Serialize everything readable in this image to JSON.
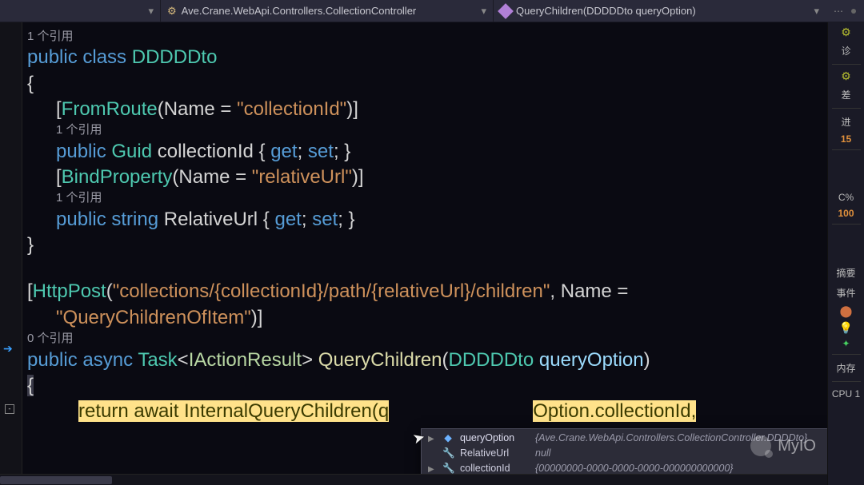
{
  "breadcrumb": {
    "class_label": "Ave.Crane.WebApi.Controllers.CollectionController",
    "method_label": "QueryChildren(DDDDDto queryOption)"
  },
  "rightstrip": {
    "diag_label": "诊",
    "diff_label": "差",
    "proc_label": "进",
    "num1": "15",
    "cpu_label": "C%",
    "cpu_value": "100",
    "summary_label": "摘要",
    "events_label": "事件",
    "mem_label": "内存",
    "cpu2_label": "CPU 1"
  },
  "code": {
    "ref1": "1 个引用",
    "class_decl": {
      "kw": "public class",
      "name": "DDDDDto"
    },
    "brace_open": "{",
    "attr1": {
      "open": "[",
      "name": "FromRoute",
      "args": "(Name = ",
      "str": "\"collectionId\"",
      "close": ")]"
    },
    "ref2": "1 个引用",
    "prop1": {
      "kw1": "public",
      "type": "Guid",
      "name": "collectionId",
      "acc_open": " { ",
      "get": "get",
      "semi1": "; ",
      "set": "set",
      "semi2": "; }",
      "close": ""
    },
    "attr2": {
      "open": "[",
      "name": "BindProperty",
      "args": "(Name = ",
      "str": "\"relativeUrl\"",
      "close": ")]"
    },
    "ref3": "1 个引用",
    "prop2": {
      "kw1": "public",
      "type": "string",
      "name": "RelativeUrl",
      "acc_open": " { ",
      "get": "get",
      "semi1": "; ",
      "set": "set",
      "semi2": "; }"
    },
    "brace_close": "}",
    "attr3a": {
      "open": "[",
      "name": "HttpPost",
      "args": "(",
      "str": "\"collections/{collectionId}/path/{relativeUrl}/children\"",
      "tail": ", Name ="
    },
    "attr3b": {
      "str": "\"QueryChildrenOfItem\"",
      "close": ")]"
    },
    "ref4": "0 个引用",
    "method": {
      "kw": "public async",
      "ret1": "Task",
      "lt": "<",
      "ret2": "IActionResult",
      "gt": ">",
      "name": "QueryChildren",
      "popen": "(",
      "ptype": "DDDDDto",
      "pname": "queryOption",
      "pclose": ")"
    },
    "brace_open2": "{",
    "ret_line": {
      "kw": "return await",
      "call": " InternalQueryChildren(",
      "tail_a": "q",
      "tail_b": "Option.collectionId,"
    }
  },
  "debugtip": {
    "rows": [
      {
        "glyph": "◆",
        "exp": "▶",
        "name": "queryOption",
        "val": "{Ave.Crane.WebApi.Controllers.CollectionController.DDDDto}"
      },
      {
        "glyph": "🔧",
        "exp": "",
        "name": "RelativeUrl",
        "val": "null"
      },
      {
        "glyph": "🔧",
        "exp": "▶",
        "name": "collectionId",
        "val": "{00000000-0000-0000-0000-000000000000}"
      }
    ]
  },
  "watermark": {
    "text": "MyIO"
  }
}
